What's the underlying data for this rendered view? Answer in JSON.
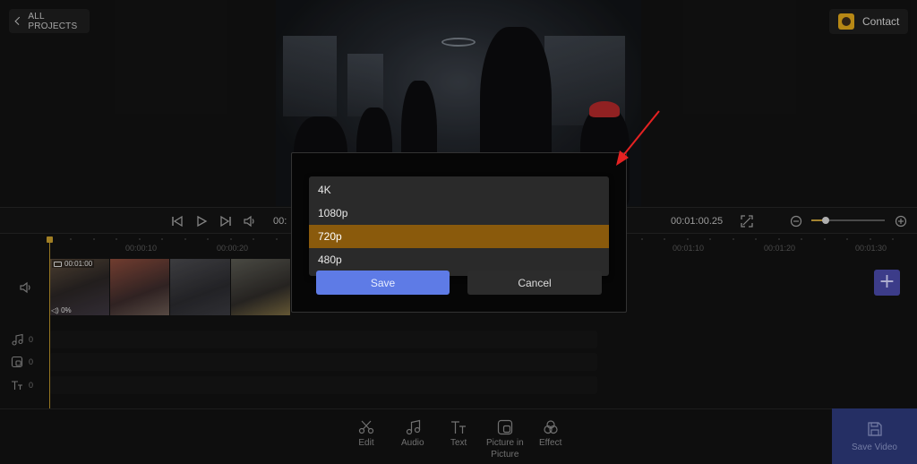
{
  "header": {
    "back_label": "ALL PROJECTS",
    "contact_label": "Contact"
  },
  "player": {
    "time_current": "00:",
    "time_total": "00:01:00.25",
    "zoom_level": 0.2
  },
  "ruler": {
    "labels": [
      "00:00:10",
      "00:00:20",
      "00:01:10",
      "00:01:20",
      "00:01:30"
    ]
  },
  "tracks": {
    "video_clip_duration": "00:01:00",
    "video_clip_volume": "0%",
    "music_count": "0",
    "pip_count": "0",
    "text_count": "0"
  },
  "dialog": {
    "options": [
      "4K",
      "1080p",
      "720p",
      "480p"
    ],
    "selected": "720p",
    "save_label": "Save",
    "cancel_label": "Cancel"
  },
  "toolbar": {
    "edit_label": "Edit",
    "audio_label": "Audio",
    "text_label": "Text",
    "pip_label_1": "Picture in",
    "pip_label_2": "Picture",
    "effect_label": "Effect",
    "save_video_label": "Save Video"
  },
  "colors": {
    "accent_gold": "#8a5a0c",
    "primary_blue": "#5e7be6",
    "annotation_red": "#e52222"
  }
}
